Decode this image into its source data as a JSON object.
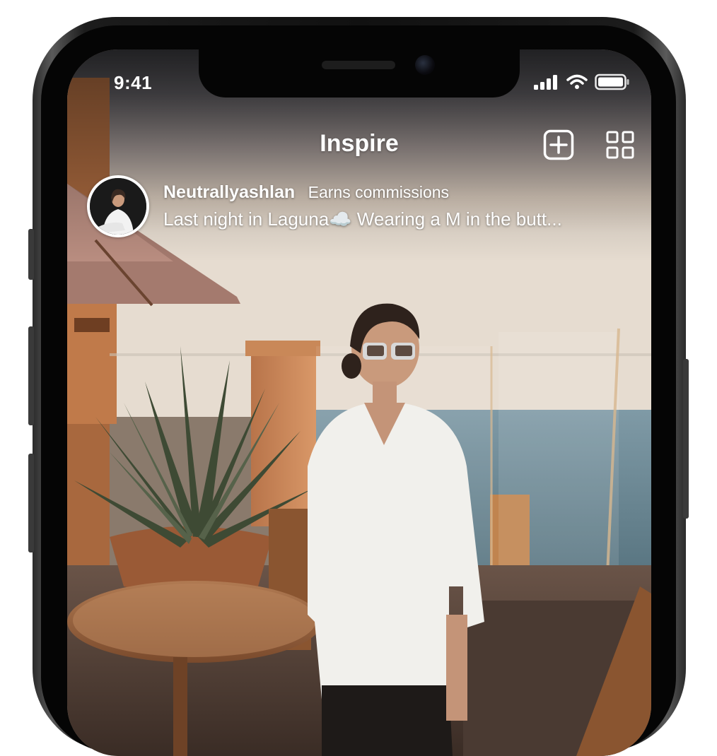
{
  "status_bar": {
    "time": "9:41"
  },
  "header": {
    "title": "Inspire",
    "add_icon": "plus-square-icon",
    "grid_icon": "grid-icon"
  },
  "post": {
    "username": "Neutrallyashlan",
    "badge": "Earns commissions",
    "caption": "Last night in Laguna☁️ Wearing a M in the butt..."
  },
  "colors": {
    "text": "#ffffff",
    "frame": "#1a1a1a"
  }
}
